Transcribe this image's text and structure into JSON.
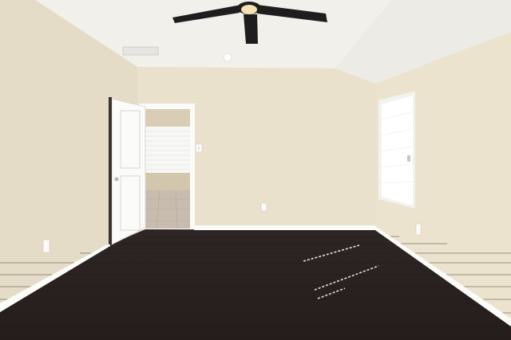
{
  "scene": {
    "colors": {
      "ceiling": "#f2f0eb",
      "ceiling_slope": "#ecebe6",
      "left_wall": "#e4dcc6",
      "back_wall": "#e9e1cb",
      "right_wall": "#ebe3cd",
      "floor": "#2e2624",
      "floor_dark": "#241d1b",
      "baseboard": "#fbfbf9",
      "door": "#fbfbfa",
      "window_glass": "#ffffff",
      "fan": "#1e1e1e",
      "fan_light": "#f4e2b0",
      "hall_floor": "#c7bcad",
      "hall_wall": "#d9cdb5"
    },
    "icons": [
      "ceiling-fan-icon",
      "ceiling-vent-icon",
      "smoke-detector-icon",
      "light-switch-icon",
      "outlet-icon"
    ]
  }
}
